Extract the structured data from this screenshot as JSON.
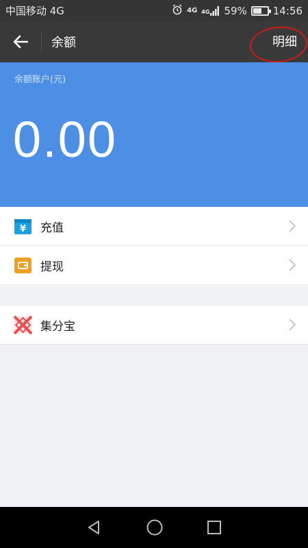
{
  "status_bar": {
    "carrier": "中国移动 4G",
    "net_badge_1": "4G",
    "net_badge_2": "4G",
    "battery_percent": "59%",
    "battery_level": 0.59,
    "time": "14:56"
  },
  "header": {
    "title": "余额",
    "detail_label": "明细"
  },
  "balance": {
    "label": "余额账户(元)",
    "amount": "0.00"
  },
  "menu": {
    "items": [
      {
        "label": "充值",
        "icon": "recharge-icon",
        "color": "#1aa1e4"
      },
      {
        "label": "提现",
        "icon": "withdraw-icon",
        "color": "#f0a01e"
      },
      {
        "label": "集分宝",
        "icon": "jifenbao-icon",
        "color": "#e8504f"
      }
    ]
  },
  "colors": {
    "balance_bg": "#4e8fe6",
    "topbar_bg": "#393939",
    "page_bg": "#f0f1f5",
    "highlight": "#d11a1a"
  }
}
